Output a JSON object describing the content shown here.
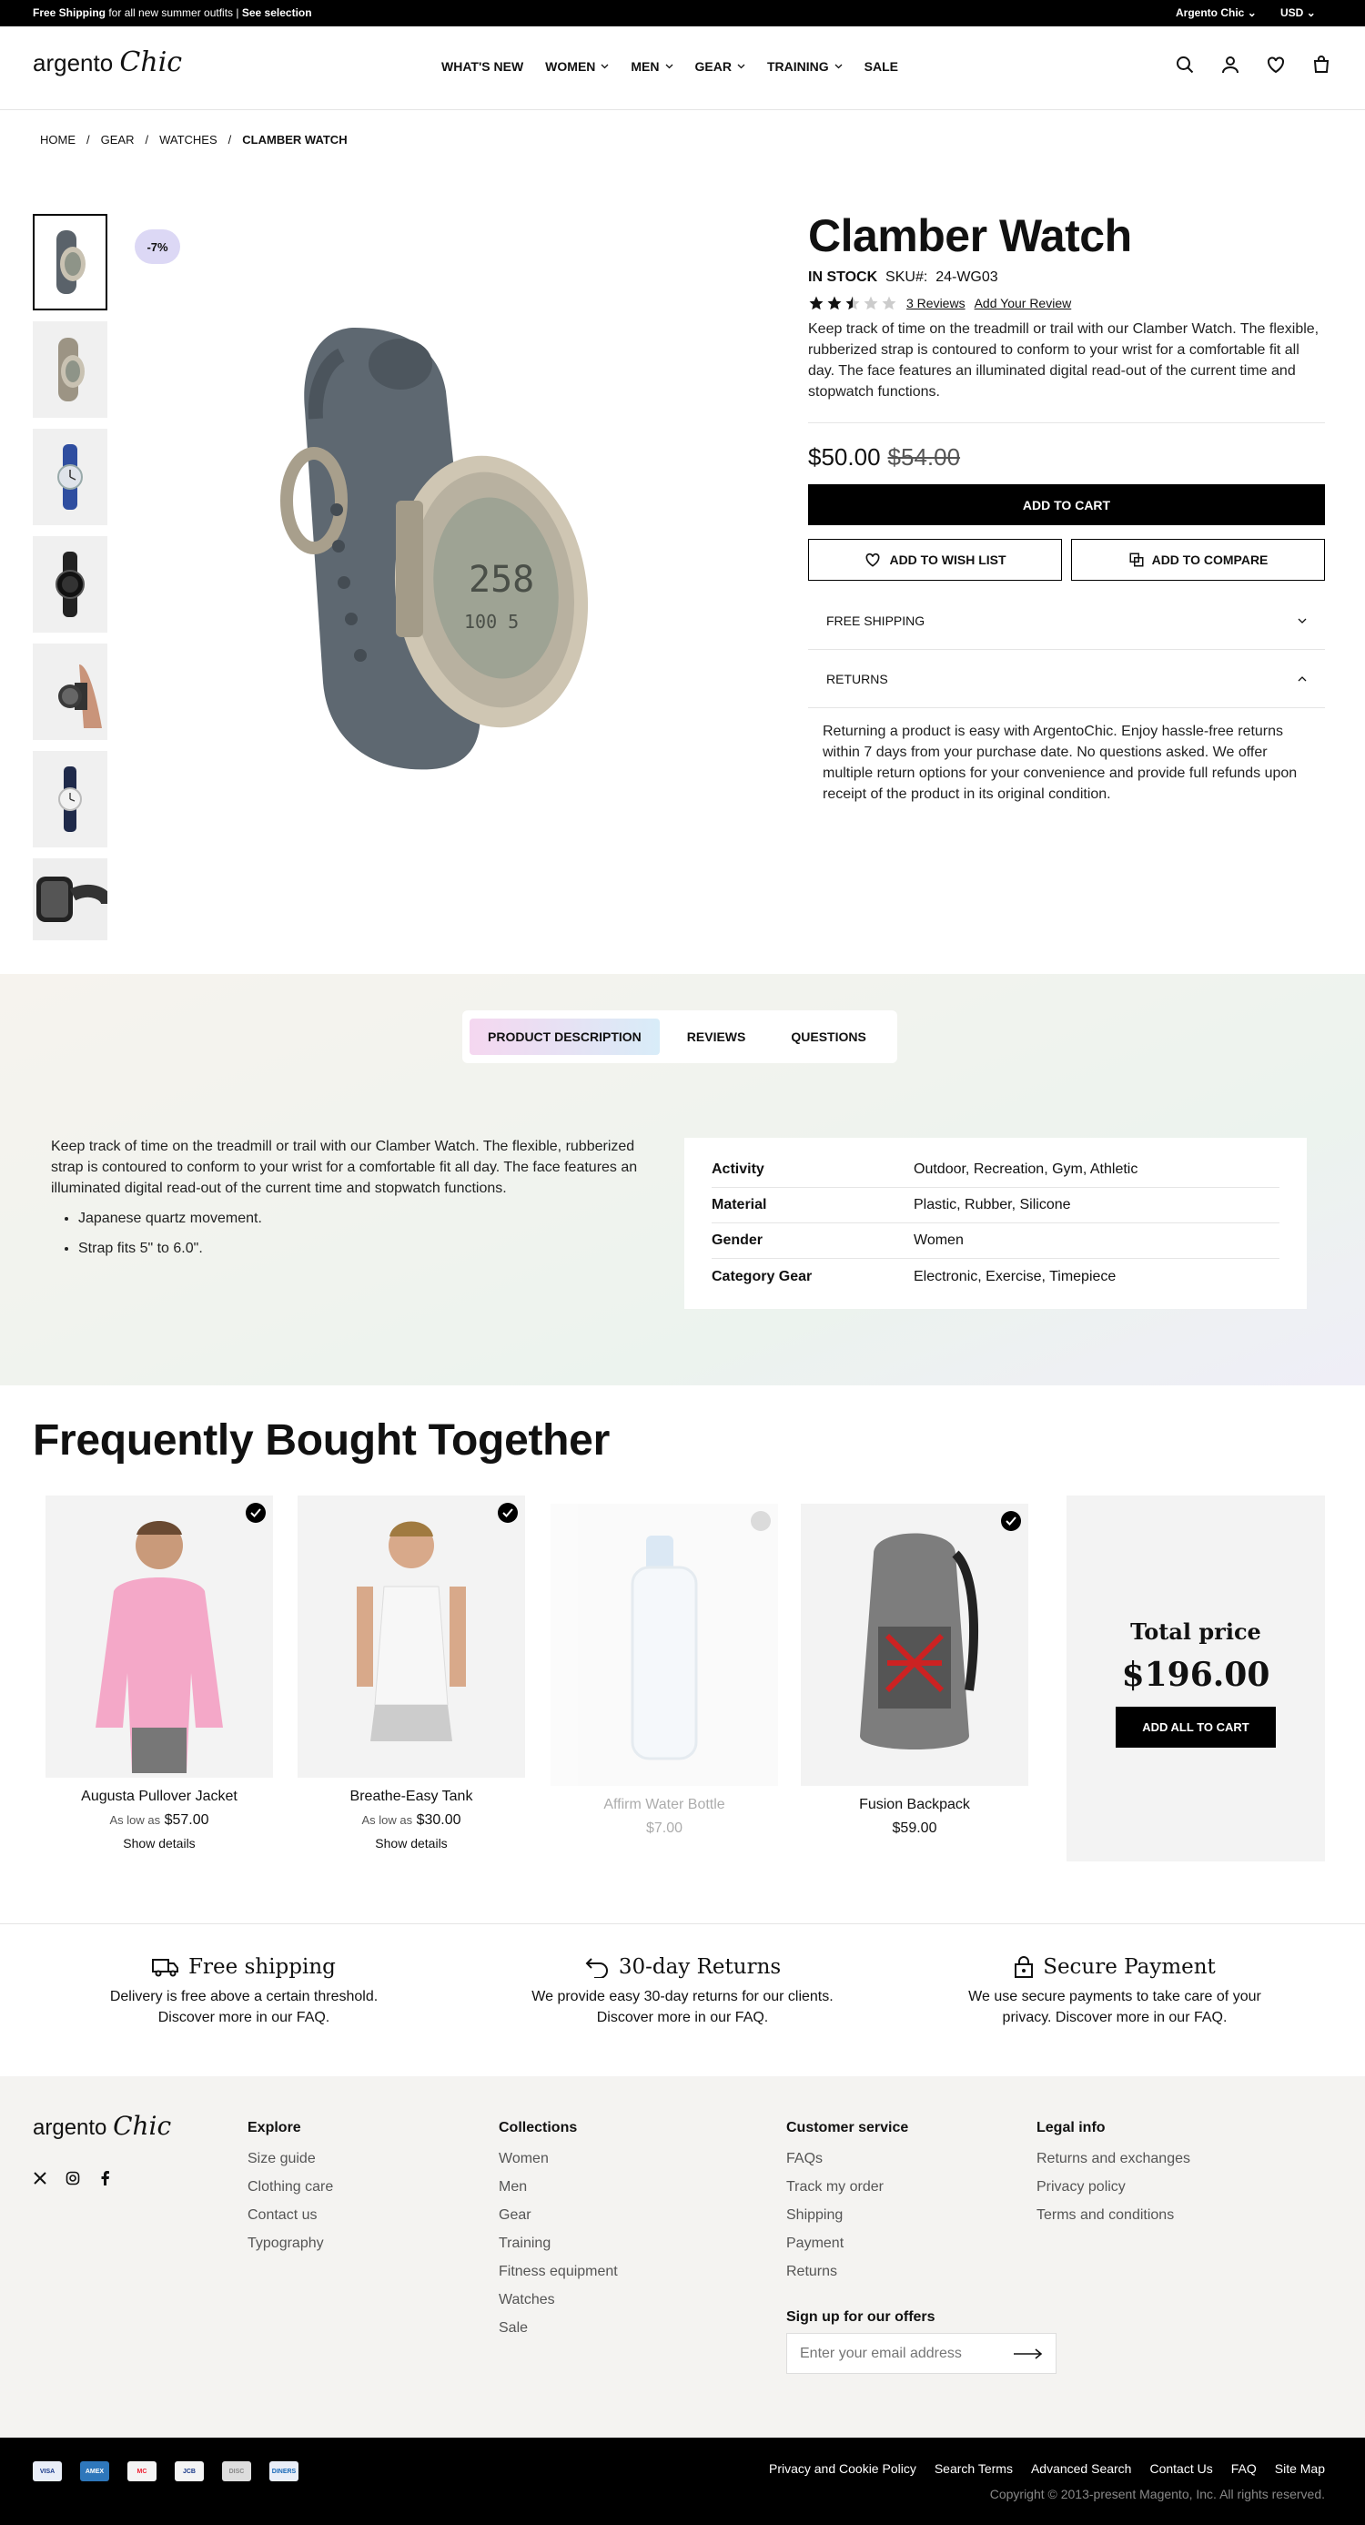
{
  "topbar": {
    "promo_bold": "Free Shipping",
    "promo_text": " for all new summer outfits | ",
    "see_selection": "See selection",
    "store": "Argento Chic",
    "currency": "USD"
  },
  "header": {
    "logo_word": "argento",
    "logo_script": "Chic",
    "nav": [
      "WHAT'S NEW",
      "WOMEN",
      "MEN",
      "GEAR",
      "TRAINING",
      "SALE"
    ]
  },
  "breadcrumb": [
    "HOME",
    "GEAR",
    "WATCHES",
    "CLAMBER WATCH"
  ],
  "product": {
    "discount_badge": "-7%",
    "name": "Clamber Watch",
    "stock": "IN STOCK",
    "sku_label": "SKU#:",
    "sku": "24-WG03",
    "rating": 2.5,
    "reviews_link": "3  Reviews",
    "add_review": "Add Your Review",
    "description": "Keep track of time on the treadmill or trail with our Clamber Watch. The flexible, rubberized strap is contoured to conform to your wrist for a comfortable fit all day. The face features an illuminated digital read-out of the current time and stopwatch functions.",
    "price": "$50.00",
    "old_price": "$54.00",
    "add_to_cart": "ADD TO CART",
    "add_to_wishlist": "ADD TO WISH LIST",
    "add_to_compare": "ADD TO COMPARE",
    "accordion": [
      {
        "title": "FREE SHIPPING",
        "open": false
      },
      {
        "title": "RETURNS",
        "open": true
      }
    ],
    "returns_text": "Returning a product is easy with ArgentoChic. Enjoy hassle-free returns within 7 days from your purchase date. No questions asked. We offer multiple return options for your convenience and provide full refunds upon receipt of the product in its original condition."
  },
  "tabs": [
    "PRODUCT DESCRIPTION",
    "REVIEWS",
    "QUESTIONS"
  ],
  "details": {
    "text": "Keep track of time on the treadmill or trail with our Clamber Watch. The flexible, rubberized strap is contoured to conform to your wrist for a comfortable fit all day. The face features an illuminated digital read-out of the current time and stopwatch functions.",
    "bullets": [
      "Japanese quartz movement.",
      "Strap fits 5\" to 6.0\"."
    ],
    "attributes": [
      {
        "k": "Activity",
        "v": "Outdoor, Recreation, Gym, Athletic"
      },
      {
        "k": "Material",
        "v": "Plastic, Rubber, Silicone"
      },
      {
        "k": "Gender",
        "v": "Women"
      },
      {
        "k": "Category Gear",
        "v": "Electronic, Exercise, Timepiece"
      }
    ]
  },
  "fbt": {
    "title": "Frequently Bought Together",
    "items": [
      {
        "name": "Augusta Pullover Jacket",
        "as_low": "As low as",
        "price": "$57.00",
        "details": "Show details",
        "checked": true
      },
      {
        "name": "Breathe-Easy Tank",
        "as_low": "As low as",
        "price": "$30.00",
        "details": "Show details",
        "checked": true
      },
      {
        "name": "Affirm Water Bottle",
        "price": "$7.00",
        "checked": false
      },
      {
        "name": "Fusion Backpack",
        "price": "$59.00",
        "checked": true
      }
    ],
    "total_label": "Total price",
    "total": "$196.00",
    "add_all": "ADD ALL TO CART"
  },
  "features": [
    {
      "title": "Free shipping",
      "text": "Delivery is free above a certain threshold. Discover more in our FAQ.",
      "icon": "truck-icon"
    },
    {
      "title": "30-day Returns",
      "text": "We provide easy 30-day returns for our clients. Discover more in our FAQ.",
      "icon": "return-arrow-icon"
    },
    {
      "title": "Secure Payment",
      "text": "We use secure payments to take care of your privacy. Discover more in our FAQ.",
      "icon": "lock-icon"
    }
  ],
  "footer": {
    "explore": {
      "title": "Explore",
      "links": [
        "Size guide",
        "Clothing care",
        "Contact us",
        "Typography"
      ]
    },
    "collections": {
      "title": "Collections",
      "links": [
        "Women",
        "Men",
        "Gear",
        "Training",
        "Fitness equipment",
        "Watches",
        "Sale"
      ]
    },
    "customer": {
      "title": "Customer service",
      "links": [
        "FAQs",
        "Track my order",
        "Shipping",
        "Payment",
        "Returns"
      ]
    },
    "legal": {
      "title": "Legal info",
      "links": [
        "Returns and exchanges",
        "Privacy policy",
        "Terms and conditions"
      ]
    },
    "signup_title": "Sign up for our offers",
    "email_placeholder": "Enter your email address",
    "bottom_links": [
      "Privacy and Cookie Policy",
      "Search Terms",
      "Advanced Search",
      "Contact Us",
      "FAQ",
      "Site Map"
    ],
    "copyright": "Copyright © 2013-present Magento, Inc. All rights reserved.",
    "payments": [
      "VISA",
      "AMEX",
      "MC",
      "JCB",
      "DISC",
      "DINERS"
    ]
  }
}
